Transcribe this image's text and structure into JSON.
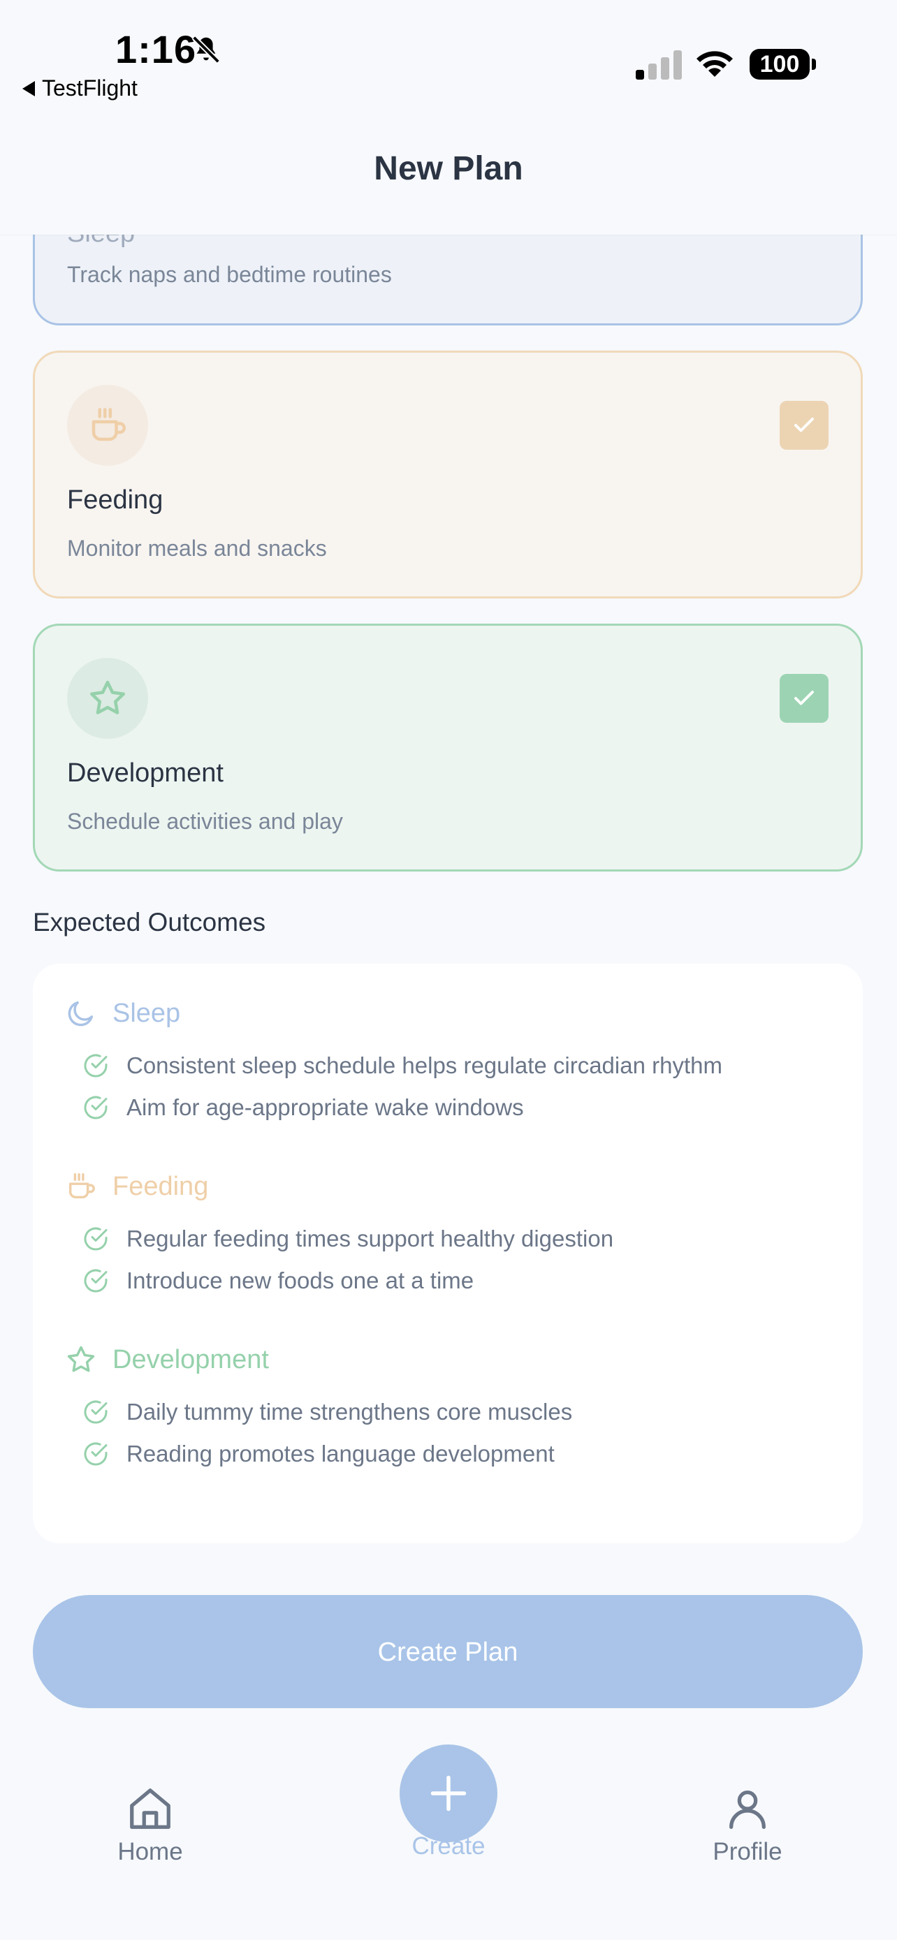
{
  "status_bar": {
    "time": "1:16",
    "back_label": "TestFlight",
    "battery": "100"
  },
  "header": {
    "title": "New Plan"
  },
  "categories": [
    {
      "name": "Sleep",
      "description": "Track naps and bedtime routines",
      "selected": true,
      "color": "#a9c3e6"
    },
    {
      "name": "Feeding",
      "description": "Monitor meals and snacks",
      "selected": true,
      "color": "#f1d9b8"
    },
    {
      "name": "Development",
      "description": "Schedule activities and play",
      "selected": true,
      "color": "#a3d8b6"
    }
  ],
  "outcomes": {
    "title": "Expected Outcomes",
    "groups": [
      {
        "name": "Sleep",
        "icon": "moon-icon",
        "color": "#a9c3e6",
        "items": [
          "Consistent sleep schedule helps regulate circadian rhythm",
          "Aim for age-appropriate wake windows"
        ]
      },
      {
        "name": "Feeding",
        "icon": "cup-icon",
        "color": "#efcfa8",
        "items": [
          "Regular feeding times support healthy digestion",
          "Introduce new foods one at a time"
        ]
      },
      {
        "name": "Development",
        "icon": "star-icon",
        "color": "#95d1ab",
        "items": [
          "Daily tummy time strengthens core muscles",
          "Reading promotes language development"
        ]
      }
    ]
  },
  "create_button": {
    "label": "Create Plan"
  },
  "bottom_nav": {
    "home": "Home",
    "create": "Create",
    "profile": "Profile"
  }
}
